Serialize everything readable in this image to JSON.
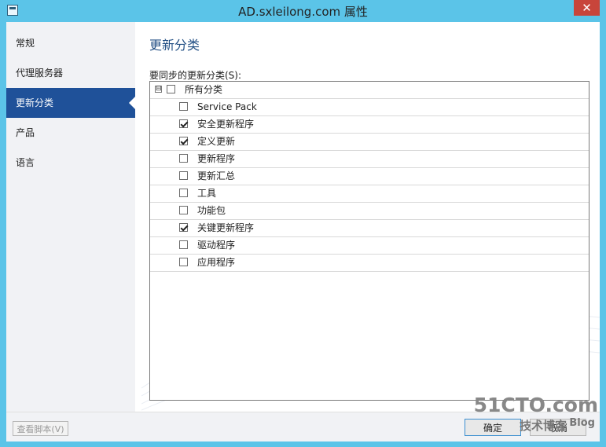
{
  "window": {
    "title": "AD.sxleilong.com 属性",
    "close_symbol": "✕"
  },
  "sidebar": {
    "items": [
      {
        "label": "常规"
      },
      {
        "label": "代理服务器"
      },
      {
        "label": "更新分类"
      },
      {
        "label": "产品"
      },
      {
        "label": "语言"
      }
    ]
  },
  "main": {
    "title": "更新分类",
    "list_label": "要同步的更新分类(S):",
    "root": {
      "label": "所有分类",
      "expander": "⊟",
      "checked": false
    },
    "items": [
      {
        "label": "Service Pack",
        "checked": false
      },
      {
        "label": "安全更新程序",
        "checked": true
      },
      {
        "label": "定义更新",
        "checked": true
      },
      {
        "label": "更新程序",
        "checked": false
      },
      {
        "label": "更新汇总",
        "checked": false
      },
      {
        "label": "工具",
        "checked": false
      },
      {
        "label": "功能包",
        "checked": false
      },
      {
        "label": "关键更新程序",
        "checked": true
      },
      {
        "label": "驱动程序",
        "checked": false
      },
      {
        "label": "应用程序",
        "checked": false
      }
    ]
  },
  "footer": {
    "view_script": "查看脚本(V)",
    "ok": "确定",
    "cancel": "取消"
  },
  "watermark": {
    "main": "51CTO.com",
    "sub": "技术博客",
    "blog": "Blog"
  }
}
